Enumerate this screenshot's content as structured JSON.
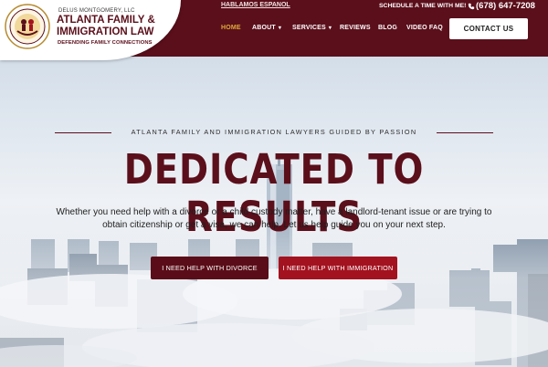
{
  "header": {
    "firm_small": "DELUS MONTGOMERY, LLC",
    "firm_name_1": "ATLANTA FAMILY &",
    "firm_name_2": "IMMIGRATION LAW",
    "tagline": "DEFENDING FAMILY CONNECTIONS",
    "hablamos": "HABLAMOS ESPANOL",
    "schedule": "SCHEDULE A TIME WITH ME!",
    "phone": "(678) 647-7208",
    "nav": [
      "HOME",
      "ABOUT",
      "SERVICES",
      "REVIEWS",
      "BLOG",
      "VIDEO FAQ"
    ],
    "contact_button": "CONTACT US"
  },
  "hero": {
    "eyebrow": "ATLANTA FAMILY AND IMMIGRATION LAWYERS GUIDED BY PASSION",
    "headline": "DEDICATED TO RESULTS",
    "subtext": "Whether you need help with a divorce or a child custody matter, have a landlord-tenant issue or are trying to obtain citizenship or get a visa, we can help. Let us help guide you on your next step.",
    "button_divorce": "I NEED HELP WITH DIVORCE",
    "button_immigration": "I NEED HELP WITH IMMIGRATION"
  },
  "colors": {
    "brand": "#5b0f1b",
    "accent": "#e0a93a",
    "button_red": "#a3121f"
  },
  "icons": {
    "phone": "phone-icon",
    "logo": "law-firm-seal-icon",
    "dropdown": "chevron-down-icon"
  }
}
